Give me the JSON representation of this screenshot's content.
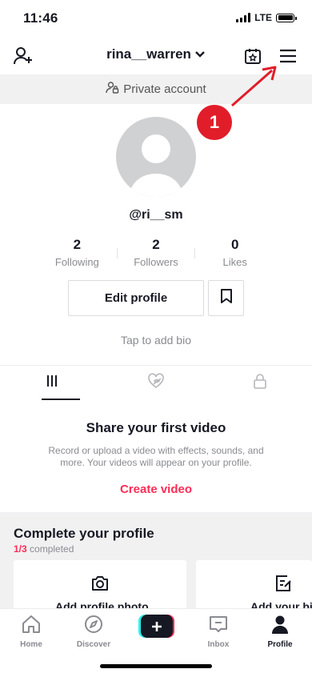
{
  "status": {
    "time": "11:46",
    "network": "LTE"
  },
  "header": {
    "username": "rina__warren"
  },
  "private_bar": {
    "label": "Private account"
  },
  "annotation": {
    "number": "1",
    "color": "#e11d2a"
  },
  "profile": {
    "handle": "@ri__sm",
    "stats": [
      {
        "value": "2",
        "label": "Following"
      },
      {
        "value": "2",
        "label": "Followers"
      },
      {
        "value": "0",
        "label": "Likes"
      }
    ],
    "edit_label": "Edit profile",
    "bio_prompt": "Tap to add bio"
  },
  "empty_state": {
    "title": "Share your first video",
    "description": "Record or upload a video with effects, sounds, and more. Your videos will appear on your profile.",
    "cta": "Create video"
  },
  "complete_profile": {
    "title": "Complete your profile",
    "progress": "1/3",
    "progress_suffix": " completed",
    "cards": [
      {
        "icon": "camera-icon",
        "label": "Add profile photo"
      },
      {
        "icon": "edit-note-icon",
        "label": "Add your bio"
      }
    ]
  },
  "nav": {
    "items": [
      {
        "label": "Home",
        "icon": "home-icon"
      },
      {
        "label": "Discover",
        "icon": "compass-icon"
      },
      {
        "label": "",
        "icon": "plus-icon"
      },
      {
        "label": "Inbox",
        "icon": "inbox-icon"
      },
      {
        "label": "Profile",
        "icon": "person-icon"
      }
    ]
  },
  "colors": {
    "accent": "#fe2c55",
    "text": "#161823",
    "muted": "#8a8b91"
  }
}
